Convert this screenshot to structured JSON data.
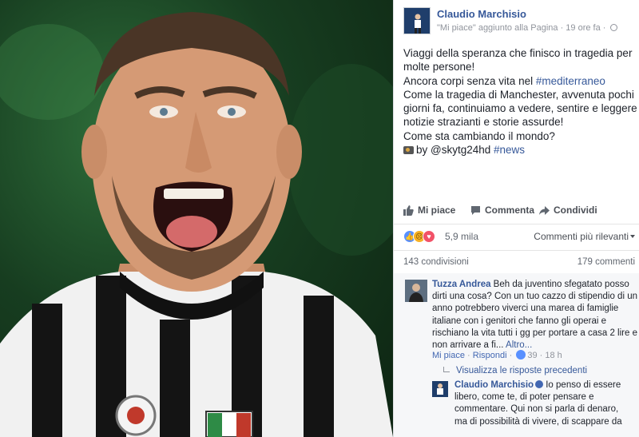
{
  "post": {
    "author": "Claudio Marchisio",
    "meta": "\"Mi piace\" aggiunto alla Pagina · 19 ore fa ·",
    "text_lines": [
      [
        {
          "t": "Viaggi della speranza che finisco in tragedia per"
        }
      ],
      [
        {
          "t": "molte persone!"
        }
      ],
      [
        {
          "t": "Ancora corpi senza vita nel "
        },
        {
          "t": "#mediterraneo",
          "tag": true
        }
      ],
      [
        {
          "t": "Come la tragedia di Manchester, avvenuta pochi"
        }
      ],
      [
        {
          "t": "giorni fa, continuiamo a vedere, sentire e leggere"
        }
      ],
      [
        {
          "t": "notizie strazianti e storie assurde!"
        }
      ],
      [
        {
          "t": "Come sta cambiando il mondo?"
        }
      ],
      [
        {
          "cam": true
        },
        {
          "t": "by @skytg24hd "
        },
        {
          "t": "#news",
          "tag": true
        }
      ]
    ]
  },
  "actions": {
    "like": "Mi piace",
    "comment": "Commenta",
    "share": "Condividi"
  },
  "reactions": {
    "count": "5,9 mila",
    "sort_label": "Commenti più rilevanti",
    "shares": "143 condivisioni",
    "comments": "179 commenti"
  },
  "comment1": {
    "name": "Tuzza Andrea",
    "first_line": " Beh da juventino sfegatato posso",
    "lines": [
      "dirti una cosa? Con un tuo cazzo di stipendio di un",
      "anno potrebbero viverci una marea di famiglie",
      "italiane con i genitori che fanno gli operai e",
      "rischiano la vita tutti i gg per portare a casa 2 lire e"
    ],
    "last_line": "non arrivare a fi... ",
    "more": "Altro...",
    "like": "Mi piace",
    "reply": "Rispondi",
    "likes": "39",
    "time": "18 h"
  },
  "previous_replies": "Visualizza le risposte precedenti",
  "comment2": {
    "name": "Claudio Marchisio",
    "first_line": " Io penso di essere",
    "lines": [
      "libero, come te, di poter pensare e",
      "commentare. Qui non si parla di denaro,",
      "ma di possibilità di vivere, di scappare da"
    ]
  },
  "colors": {
    "link": "#365899",
    "like_blue": "#5890ff",
    "love_red": "#f25268",
    "sad_yellow": "#f7b125"
  },
  "icons": [
    "thumbs-up-icon",
    "comment-icon",
    "share-arrow-icon",
    "globe-icon",
    "camera-emoji-icon",
    "verified-badge-icon"
  ]
}
